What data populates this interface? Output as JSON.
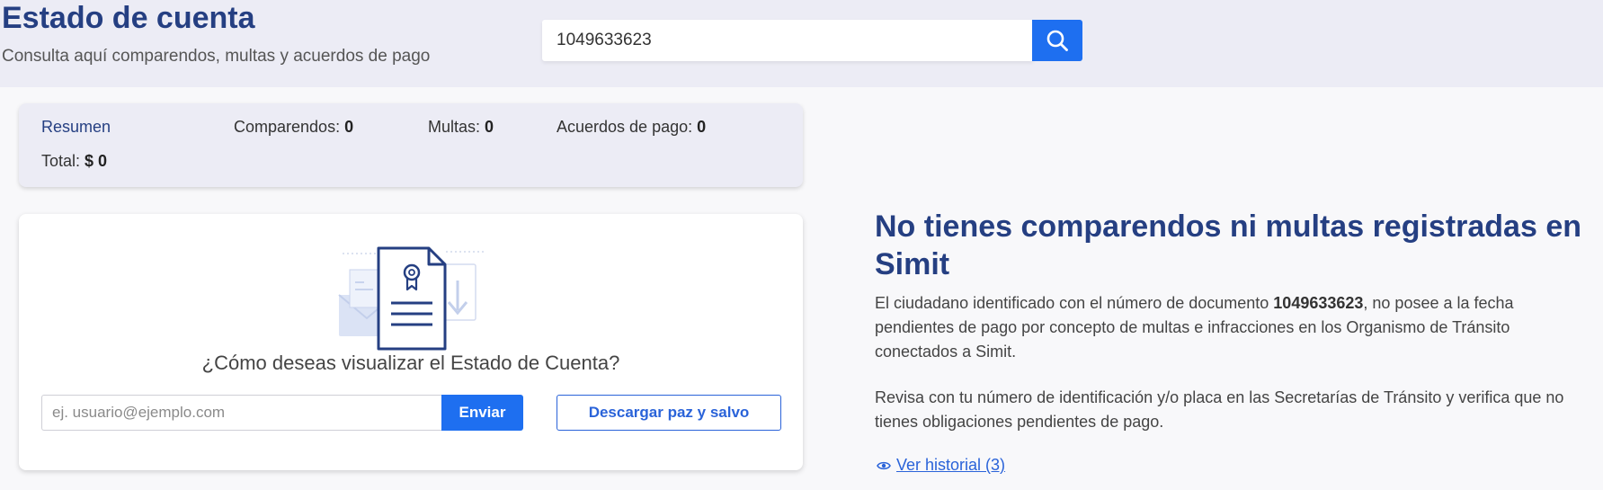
{
  "header": {
    "title": "Estado de cuenta",
    "subtitle": "Consulta aquí comparendos, multas y acuerdos de pago",
    "search_value": "1049633623"
  },
  "summary": {
    "resumen_label": "Resumen",
    "comparendos_label": "Comparendos:",
    "comparendos_value": "0",
    "multas_label": "Multas:",
    "multas_value": "0",
    "acuerdos_label": "Acuerdos de pago:",
    "acuerdos_value": "0",
    "total_label": "Total:",
    "total_value": "$ 0"
  },
  "options": {
    "question": "¿Cómo deseas visualizar el Estado de Cuenta?",
    "email_placeholder": "ej. usuario@ejemplo.com",
    "enviar_label": "Enviar",
    "descargar_label": "Descargar paz y salvo"
  },
  "message": {
    "title": "No tienes comparendos ni multas registradas en Simit",
    "p1_before": "El ciudadano identificado con el número de documento ",
    "p1_document": "1049633623",
    "p1_after": ", no posee a la fecha pendientes de pago por concepto de multas e infracciones en los Organismo de Tránsito conectados a Simit.",
    "p2": "Revisa con tu número de identificación y/o placa en las Secretarías de Tránsito y verifica que no tienes obligaciones pendientes de pago.",
    "historial_label": "Ver historial (3)"
  },
  "icons": {
    "search": "search-icon",
    "illustration": "certificate-document-illustration",
    "eye": "eye-icon"
  },
  "colors": {
    "primary": "#1e6ff0",
    "title_navy": "#253f82",
    "header_bg": "#ececf5"
  }
}
